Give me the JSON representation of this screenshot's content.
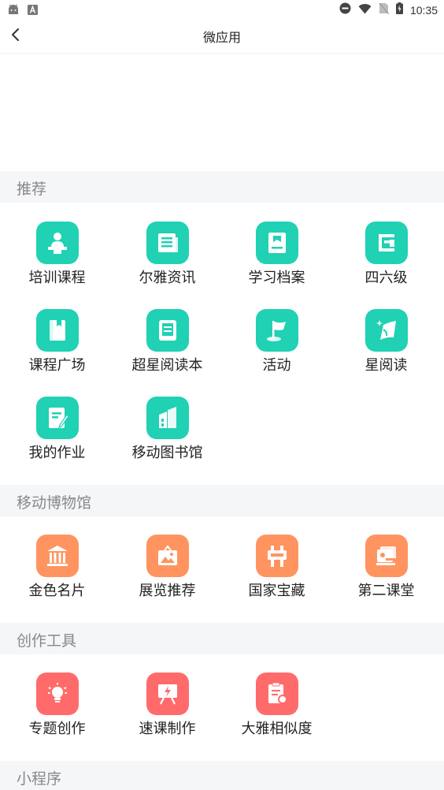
{
  "status_bar": {
    "time": "10:35",
    "left_icons": [
      "android-icon",
      "a-badge-icon"
    ],
    "right_icons": [
      "dnd-icon",
      "wifi-icon",
      "sim-off-icon",
      "battery-icon"
    ]
  },
  "nav": {
    "title": "微应用",
    "back_icon": "chevron-left-icon"
  },
  "sections": [
    {
      "title": "推荐",
      "color": "#20d1b4",
      "items": [
        {
          "label": "培训课程",
          "icon": "trainer-icon"
        },
        {
          "label": "尔雅资讯",
          "icon": "newspaper-icon"
        },
        {
          "label": "学习档案",
          "icon": "archive-book-icon"
        },
        {
          "label": "四六级",
          "icon": "cet-icon"
        },
        {
          "label": "课程广场",
          "icon": "course-book-icon"
        },
        {
          "label": "超星阅读本",
          "icon": "ebook-reader-icon"
        },
        {
          "label": "活动",
          "icon": "flag-icon"
        },
        {
          "label": "星阅读",
          "icon": "star-read-icon"
        },
        {
          "label": "我的作业",
          "icon": "homework-icon"
        },
        {
          "label": "移动图书馆",
          "icon": "library-building-icon"
        }
      ]
    },
    {
      "title": "移动博物馆",
      "color": "#ff9460",
      "items": [
        {
          "label": "金色名片",
          "icon": "museum-icon"
        },
        {
          "label": "展览推荐",
          "icon": "exhibition-picture-icon"
        },
        {
          "label": "国家宝藏",
          "icon": "treasure-sign-icon"
        },
        {
          "label": "第二课堂",
          "icon": "second-classroom-icon"
        }
      ]
    },
    {
      "title": "创作工具",
      "color": "#ff6b6b",
      "items": [
        {
          "label": "专题创作",
          "icon": "lightbulb-icon"
        },
        {
          "label": "速课制作",
          "icon": "presentation-icon"
        },
        {
          "label": "大雅相似度",
          "icon": "similarity-check-icon"
        }
      ]
    },
    {
      "title": "小程序",
      "items": []
    }
  ]
}
